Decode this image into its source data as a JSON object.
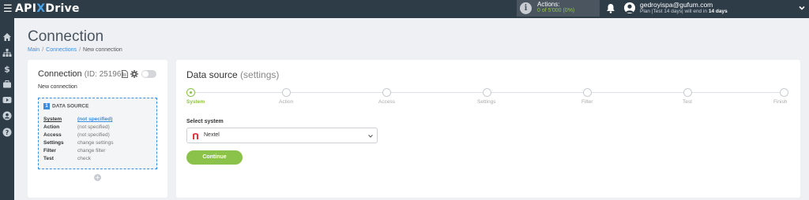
{
  "topbar": {
    "logo_left": "API",
    "logo_x": "X",
    "logo_right": "Drive",
    "actions_label": "Actions:",
    "actions_count": "0 of 5'000 (0%)",
    "user_email": "gedroyispa@gufum.com",
    "user_plan_prefix": "Plan |Test 14 days| will end in ",
    "user_plan_days": "14 days"
  },
  "sidebar": {
    "icons": [
      "home-icon",
      "sitemap-icon",
      "dollar-icon",
      "briefcase-icon",
      "video-icon",
      "user-icon",
      "help-icon"
    ]
  },
  "header": {
    "title": "Connection",
    "breadcrumb": [
      "Main",
      "Connections",
      "New connection"
    ]
  },
  "connection": {
    "title": "Connection",
    "id_text": "(ID: 25196)",
    "name": "New connection",
    "data_source": {
      "number": "1",
      "title": "DATA SOURCE",
      "rows": [
        {
          "key": "System",
          "value": "(not specified)"
        },
        {
          "key": "Action",
          "value": "(not specified)"
        },
        {
          "key": "Access",
          "value": "(not specified)"
        },
        {
          "key": "Settings",
          "value": "change settings"
        },
        {
          "key": "Filter",
          "value": "change filter"
        },
        {
          "key": "Test",
          "value": "check"
        }
      ]
    },
    "add_label": "+"
  },
  "datasource_panel": {
    "title": "Data source",
    "subtitle": "(settings)",
    "steps": [
      "System",
      "Action",
      "Access",
      "Settings",
      "Filter",
      "Test",
      "Finish"
    ],
    "active_step": 0,
    "select_label": "Select system",
    "selected_system": "Nextel",
    "continue_label": "Continue"
  },
  "colors": {
    "topbar": "#2e3c48",
    "accent_green": "#8bc24a",
    "accent_blue": "#3a8ee0",
    "nextel_red": "#e8333a"
  }
}
